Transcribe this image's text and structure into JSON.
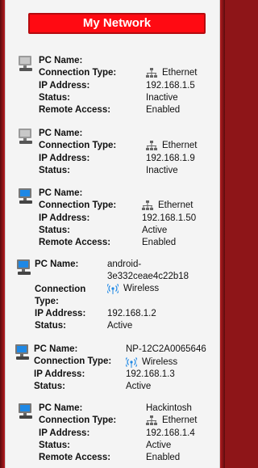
{
  "header": {
    "title": "My Network"
  },
  "labels": {
    "pc_name": "PC Name:",
    "connection_type": "Connection Type:",
    "connection": "Connection",
    "type": "Type:",
    "ip_address": "IP Address:",
    "status": "Status:",
    "remote_access": "Remote Access:"
  },
  "devices": [
    {
      "name": "",
      "connection_type": "Ethernet",
      "ip": "192.168.1.5",
      "status": "Inactive",
      "remote_access": "Enabled",
      "monitor_color": "#c8c8c8",
      "icon": "ethernet-icon"
    },
    {
      "name": "",
      "connection_type": "Ethernet",
      "ip": "192.168.1.9",
      "status": "Inactive",
      "monitor_color": "#c8c8c8",
      "icon": "ethernet-icon"
    },
    {
      "name": "",
      "connection_type": "Ethernet",
      "ip": "192.168.1.50",
      "status": "Active",
      "remote_access": "Enabled",
      "monitor_color": "#1e88e5",
      "icon": "ethernet-icon"
    },
    {
      "name": "android-3e332ceae4c22b18",
      "connection_type": "Wireless",
      "ip": "192.168.1.2",
      "status": "Active",
      "monitor_color": "#1e88e5",
      "icon": "wireless-icon"
    },
    {
      "name": "NP-12C2A0065646",
      "connection_type": "Wireless",
      "ip": "192.168.1.3",
      "status": "Active",
      "monitor_color": "#1e88e5",
      "icon": "wireless-icon"
    },
    {
      "name": "Hackintosh",
      "connection_type": "Ethernet",
      "ip": "192.168.1.4",
      "status": "Active",
      "remote_access": "Enabled",
      "monitor_color": "#1e88e5",
      "icon": "ethernet-icon"
    }
  ],
  "android_name_line1": "android-",
  "android_name_line2": "3e332ceae4c22b18"
}
